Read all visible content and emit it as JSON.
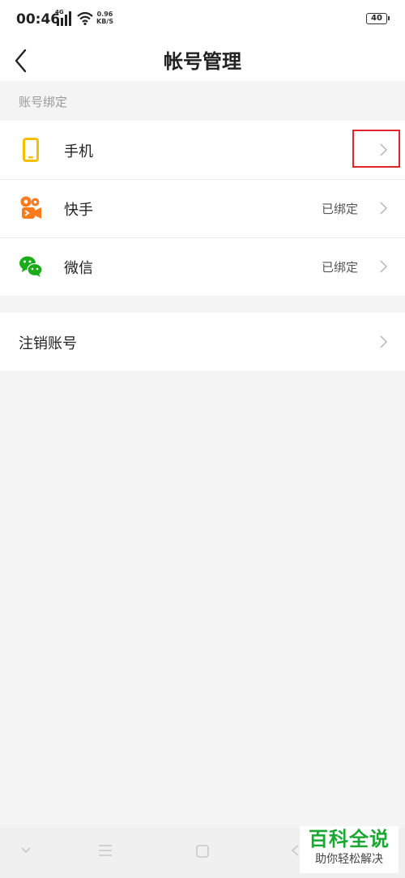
{
  "status_bar": {
    "time": "00:46",
    "network": "4G",
    "speed_value": "0.96",
    "speed_unit": "KB/S",
    "battery": "40"
  },
  "header": {
    "title": "帐号管理"
  },
  "bindings_section": {
    "header": "账号绑定",
    "items": [
      {
        "label": "手机",
        "status": "",
        "icon": "phone-icon",
        "color": "#f6c000"
      },
      {
        "label": "快手",
        "status": "已绑定",
        "icon": "kuaishou-icon",
        "color": "#ff7a1a"
      },
      {
        "label": "微信",
        "status": "已绑定",
        "icon": "wechat-icon",
        "color": "#1aad19"
      }
    ]
  },
  "account_section": {
    "cancel_label": "注销账号"
  },
  "watermark": {
    "title": "百科全说",
    "subtitle": "助你轻松解决"
  },
  "colors": {
    "highlight": "#e0262c",
    "watermark_green": "#1aa832"
  }
}
